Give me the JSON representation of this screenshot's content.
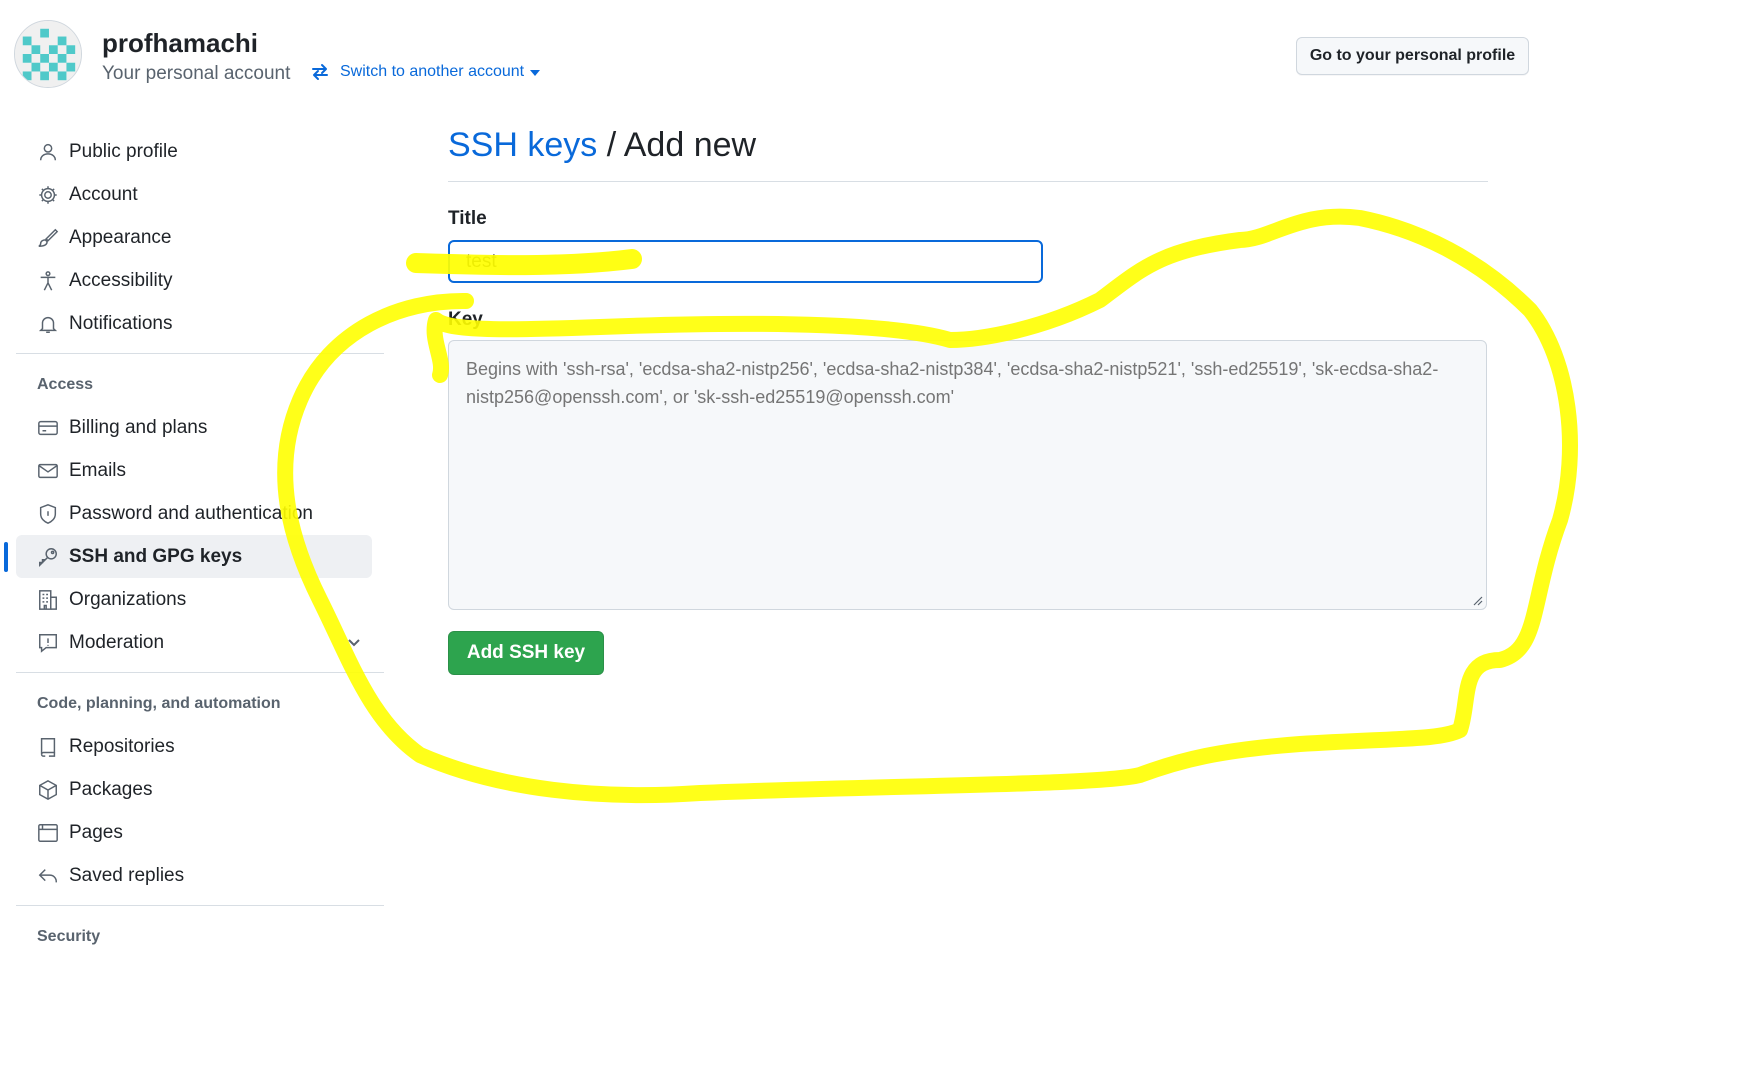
{
  "account": {
    "name": "profhamachi",
    "subtitle": "Your personal account",
    "switch_label": "Switch to another account",
    "profile_button": "Go to your personal profile"
  },
  "sidebar": {
    "items": [
      {
        "label": "Public profile",
        "icon": "person-icon"
      },
      {
        "label": "Account",
        "icon": "gear-icon"
      },
      {
        "label": "Appearance",
        "icon": "paintbrush-icon"
      },
      {
        "label": "Accessibility",
        "icon": "accessibility-icon"
      },
      {
        "label": "Notifications",
        "icon": "bell-icon"
      }
    ],
    "access_heading": "Access",
    "access_items": [
      {
        "label": "Billing and plans",
        "icon": "credit-card-icon"
      },
      {
        "label": "Emails",
        "icon": "mail-icon"
      },
      {
        "label": "Password and authentication",
        "icon": "shield-icon"
      },
      {
        "label": "SSH and GPG keys",
        "icon": "key-icon",
        "active": true
      },
      {
        "label": "Organizations",
        "icon": "organization-icon"
      },
      {
        "label": "Moderation",
        "icon": "report-icon",
        "expandable": true
      }
    ],
    "code_heading": "Code, planning, and automation",
    "code_items": [
      {
        "label": "Repositories",
        "icon": "repo-icon"
      },
      {
        "label": "Packages",
        "icon": "package-icon"
      },
      {
        "label": "Pages",
        "icon": "browser-icon"
      },
      {
        "label": "Saved replies",
        "icon": "reply-icon"
      }
    ],
    "security_heading": "Security"
  },
  "main": {
    "breadcrumb": "SSH keys",
    "separator": "/",
    "page_title": "Add new",
    "title_label": "Title",
    "title_value": "test",
    "key_label": "Key",
    "key_placeholder": "Begins with 'ssh-rsa', 'ecdsa-sha2-nistp256', 'ecdsa-sha2-nistp384', 'ecdsa-sha2-nistp521', 'ssh-ed25519', 'sk-ecdsa-sha2-nistp256@openssh.com', or 'sk-ssh-ed25519@openssh.com'",
    "submit_label": "Add SSH key"
  },
  "colors": {
    "accent": "#0969da",
    "primary_button": "#2da44e",
    "highlighter": "#ffff00"
  }
}
